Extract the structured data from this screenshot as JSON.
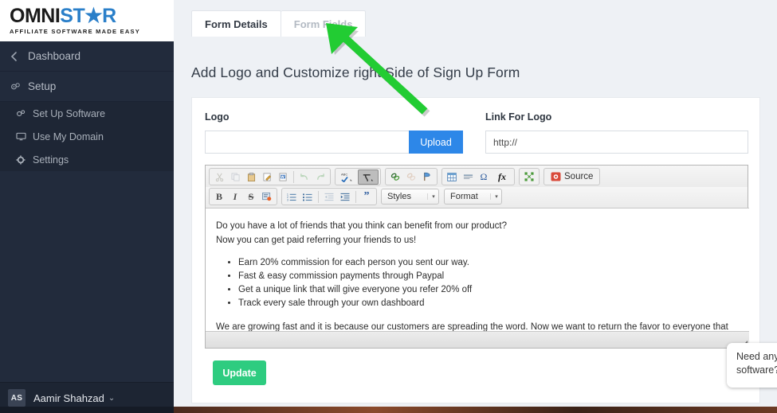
{
  "brand": {
    "logo_omni": "OMNI",
    "logo_s": "S",
    "logo_t": "T",
    "logo_star": "★",
    "logo_ar": "R",
    "tagline": "AFFILIATE SOFTWARE MADE EASY",
    "accent_blue": "#2a7fc9",
    "sidebar_bg": "#222b3c"
  },
  "sidebar": {
    "items": [
      {
        "label": "Dashboard",
        "icon": "chevron-left-icon",
        "glyph": "‹",
        "level": "top"
      },
      {
        "label": "Setup",
        "icon": "gears-icon",
        "glyph": "⚙",
        "level": "top"
      },
      {
        "label": "Set Up Software",
        "icon": "cogs-icon",
        "glyph": "⚙",
        "level": "sub"
      },
      {
        "label": "Use My Domain",
        "icon": "monitor-icon",
        "glyph": "▭",
        "level": "sub"
      },
      {
        "label": "Settings",
        "icon": "gear-icon",
        "glyph": "⚙",
        "level": "sub"
      }
    ],
    "user": {
      "initials": "AS",
      "name": "Aamir Shahzad",
      "caret": "⌄"
    }
  },
  "tabs": [
    {
      "label": "Form Details",
      "active": true
    },
    {
      "label": "Form Fields",
      "active": false
    }
  ],
  "page": {
    "title": "Add Logo and Customize right Side of Sign Up Form"
  },
  "form": {
    "logo_label": "Logo",
    "logo_value": "",
    "logo_placeholder": "",
    "upload_label": "Upload",
    "link_label": "Link For Logo",
    "link_value": "http://",
    "update_label": "Update"
  },
  "editor": {
    "toolbar_row1": [
      {
        "name": "cut-icon",
        "glyph": "✂",
        "state": "dim"
      },
      {
        "name": "copy-icon",
        "glyph": "❐",
        "state": "dim"
      },
      {
        "name": "paste-icon",
        "glyph": "ὌB",
        "state": "normal"
      },
      {
        "name": "paste-as-text-icon",
        "glyph": "✎",
        "state": "normal"
      },
      {
        "name": "paste-from-word-icon",
        "glyph": "▤",
        "state": "normal"
      },
      {
        "name": "undo-icon",
        "glyph": "↶",
        "state": "dim"
      },
      {
        "name": "redo-icon",
        "glyph": "↷",
        "state": "dim"
      }
    ],
    "toolbar_spell": [
      {
        "name": "spell-check-icon",
        "glyph": "✔",
        "label": "ABC"
      },
      {
        "name": "scayt-icon",
        "glyph": "✒",
        "state": "on"
      }
    ],
    "toolbar_link": [
      {
        "name": "link-icon",
        "glyph": "⚭",
        "state": "normal"
      },
      {
        "name": "unlink-icon",
        "glyph": "⚭",
        "state": "dim"
      },
      {
        "name": "anchor-icon",
        "glyph": "⚑",
        "state": "normal"
      }
    ],
    "toolbar_insert": [
      {
        "name": "table-icon",
        "glyph": "▦"
      },
      {
        "name": "horizontal-rule-icon",
        "glyph": "≡"
      },
      {
        "name": "special-character-icon",
        "glyph": "Ω"
      },
      {
        "name": "math-formula-icon",
        "glyph": "fx"
      }
    ],
    "toolbar_maximize": {
      "name": "maximize-icon",
      "glyph": "⛶"
    },
    "source_label": "Source",
    "toolbar_row2_text": [
      {
        "name": "bold-icon",
        "glyph": "B"
      },
      {
        "name": "italic-icon",
        "glyph": "I"
      },
      {
        "name": "strikethrough-icon",
        "glyph": "S"
      },
      {
        "name": "remove-format-icon",
        "glyph": "▣"
      }
    ],
    "toolbar_row2_list": [
      {
        "name": "numbered-list-icon",
        "glyph": "≣"
      },
      {
        "name": "bulleted-list-icon",
        "glyph": "☰"
      },
      {
        "name": "outdent-icon",
        "glyph": "⇤",
        "state": "dim"
      },
      {
        "name": "indent-icon",
        "glyph": "⇥"
      },
      {
        "name": "blockquote-icon",
        "glyph": "”"
      }
    ],
    "styles_label": "Styles",
    "format_label": "Format",
    "dropdown_caret": "▾",
    "content": {
      "para1": "Do you have a lot of friends that you think can benefit from our product?",
      "para2": "Now you can get paid referring your friends to us!",
      "bullets": [
        "Earn 20% commission for each person you sent our way.",
        "Fast & easy commission payments through Paypal",
        "Get a unique link that will give everyone you refer 20% off",
        "Track every sale through your own dashboard"
      ],
      "para3": "We are growing fast and it is because our customers are spreading the word. Now we want to return the favor to everyone that has helped us. Start getting paid today!"
    }
  },
  "chat": {
    "message": "Need any help Today using our software?"
  },
  "annotation": {
    "arrow_color": "#22cc33"
  }
}
